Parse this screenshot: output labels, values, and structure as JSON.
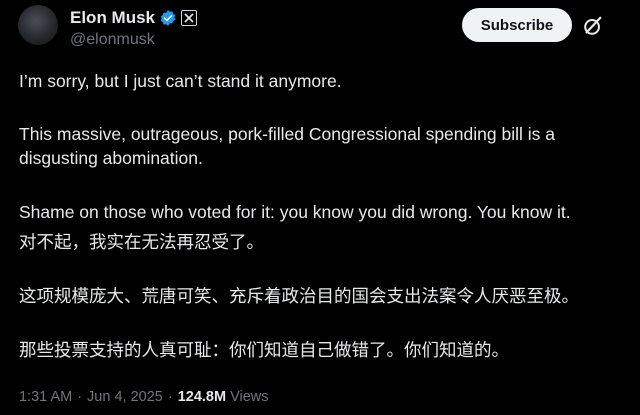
{
  "author": {
    "display_name": "Elon Musk",
    "handle": "@elonmusk",
    "verified_color": "#1d9bf0"
  },
  "header": {
    "subscribe_label": "Subscribe"
  },
  "post": {
    "paragraphs": [
      "I’m sorry, but I just can’t stand it anymore.",
      "This massive, outrageous, pork-filled Congressional spending bill is a disgusting abomination.",
      "Shame on those who voted for it: you know you did wrong. You know it.",
      "对不起，我实在无法再忍受了。",
      "这项规模庞大、荒唐可笑、充斥着政治目的国会支出法案令人厌恶至极。",
      "那些投票支持的人真可耻：你们知道自己做错了。你们知道的。"
    ]
  },
  "meta": {
    "time": "1:31 AM",
    "separator": "·",
    "date": "Jun 4, 2025",
    "views_count": "124.8M",
    "views_label": "Views"
  },
  "icons": {
    "verified": "verified-badge-icon",
    "affiliation": "x-affiliation-icon",
    "grok": "grok-icon"
  },
  "colors": {
    "background": "#000000",
    "text": "#e7e9ea",
    "secondary": "#71767b",
    "button_bg": "#eff3f4"
  }
}
